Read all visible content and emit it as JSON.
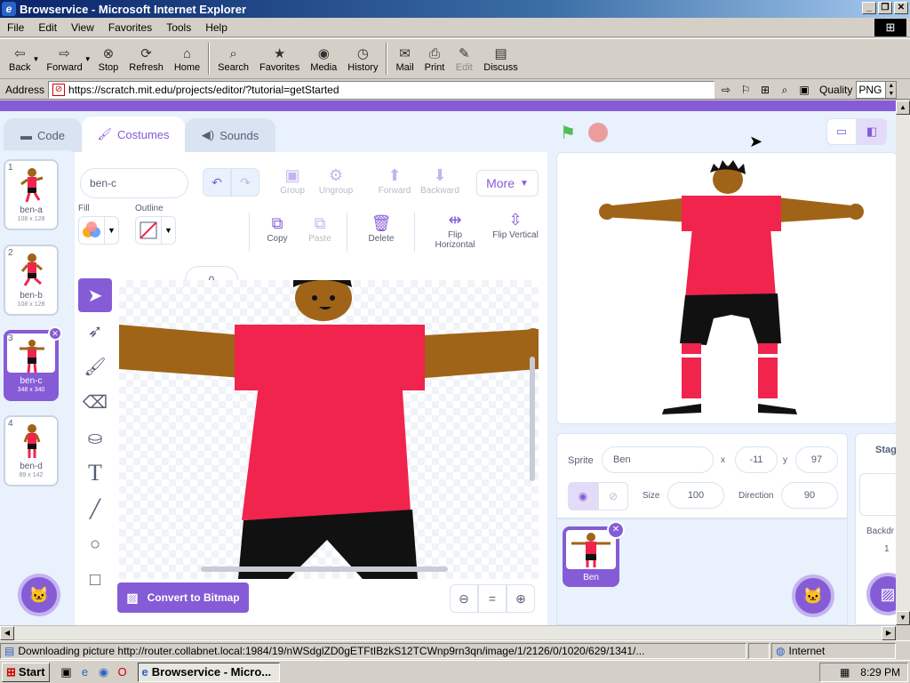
{
  "window": {
    "title": "Browservice - Microsoft Internet Explorer",
    "min": "_",
    "max": "❐",
    "close": "✕"
  },
  "menu": [
    "File",
    "Edit",
    "View",
    "Favorites",
    "Tools",
    "Help"
  ],
  "toolbar": {
    "back": "Back",
    "forward": "Forward",
    "stop": "Stop",
    "refresh": "Refresh",
    "home": "Home",
    "search": "Search",
    "favorites": "Favorites",
    "media": "Media",
    "history": "History",
    "mail": "Mail",
    "print": "Print",
    "edit": "Edit",
    "discuss": "Discuss"
  },
  "address": {
    "label": "Address",
    "url": "https://scratch.mit.edu/projects/editor/?tutorial=getStarted",
    "quality_label": "Quality",
    "quality_value": "PNG"
  },
  "scratch": {
    "tabs": {
      "code": "Code",
      "costumes": "Costumes",
      "sounds": "Sounds"
    },
    "costumes": [
      {
        "num": "1",
        "name": "ben-a",
        "size": "108 x 128"
      },
      {
        "num": "2",
        "name": "ben-b",
        "size": "108 x 128"
      },
      {
        "num": "3",
        "name": "ben-c",
        "size": "348 x 340"
      },
      {
        "num": "4",
        "name": "ben-d",
        "size": "89 x 142"
      }
    ],
    "editor": {
      "costume_name": "ben-c",
      "group": "Group",
      "ungroup": "Ungroup",
      "forward": "Forward",
      "backward": "Backward",
      "more": "More",
      "fill": "Fill",
      "outline": "Outline",
      "outline_width": "0",
      "copy": "Copy",
      "paste": "Paste",
      "delete": "Delete",
      "flip_h": "Flip Horizontal",
      "flip_v": "Flip Vertical",
      "convert": "Convert to Bitmap"
    },
    "sprite": {
      "label": "Sprite",
      "name": "Ben",
      "x_label": "x",
      "x": "-11",
      "y_label": "y",
      "y": "97",
      "size_label": "Size",
      "size": "100",
      "direction_label": "Direction",
      "direction": "90",
      "tile_name": "Ben"
    },
    "stage": {
      "label": "Stag",
      "backdrops_label": "Backdr",
      "backdrops_count": "1"
    }
  },
  "status": {
    "text": "Downloading picture http://router.collabnet.local:1984/19/nWSdglZD0gETFtIBzkS12TCWnp9rn3qn/image/1/2126/0/1020/629/1341/...",
    "zone": "Internet"
  },
  "taskbar": {
    "start": "Start",
    "task": "Browservice - Micro...",
    "time": "8:29 PM"
  },
  "colors": {
    "accent": "#855cd6",
    "shirt": "#f0244d",
    "skin": "#a06418",
    "panel": "#e9f1fc"
  }
}
